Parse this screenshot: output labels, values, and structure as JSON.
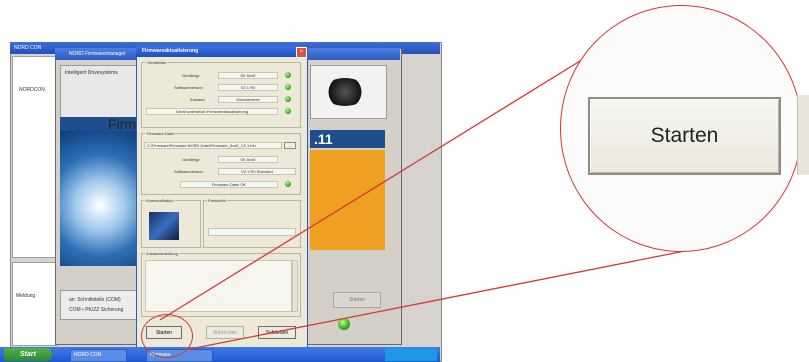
{
  "outer_window": {
    "title": "NORD CON",
    "taskbar_start": "Start",
    "taskbar_items": [
      "NORD CON",
      "Firmware"
    ],
    "tree_item": "NORDCON",
    "message_panel_label": "Meldung"
  },
  "firmware_window": {
    "title": "NORD Firmwaremanager",
    "banner_text": "Intelligent Drivesystems",
    "heading": "Firm",
    "version": ".11",
    "status_lines": [
      "an: Schnittstelle (COM)",
      "COM • PK/ZZ Sicherung"
    ],
    "ghost_button": "Starten"
  },
  "dialog": {
    "title": "Firmwareaktualisierung",
    "close_icon": "close-icon",
    "group_device": "Geräteliste",
    "rows_device": [
      {
        "label": "Gerätetyp",
        "value": "SK 5xxE"
      },
      {
        "label": "Softwareversion",
        "value": "V2.1 R0"
      },
      {
        "label": "Zustand",
        "value": "Einsatzbereit"
      }
    ],
    "device_note": "Gerät unterstützt Firmwareaktualisierung",
    "group_file": "Firmware-Datei",
    "file_path": "C:\\Firmware\\Firmware NORD Datei\\Firmware_5xxE_V2.1.bin",
    "rows_file": [
      {
        "label": "Gerätetyp",
        "value": "SK 5xxE"
      },
      {
        "label": "Softwareversion",
        "value": "V2.1 R0 Standard"
      }
    ],
    "file_ok": "Firmware-Datei OK",
    "group_comm": "Kommunikation",
    "group_progress": "Fortschritt",
    "group_log": "Zustandsmeldung",
    "buttons": {
      "start": "Starten",
      "cancel": "Abbrechen",
      "close": "Schließen"
    }
  },
  "zoom": {
    "button_label": "Starten"
  },
  "colors": {
    "annotation_red": "#d23a3a",
    "status_green": "#35a31c",
    "xp_blue": "#2b5cc4"
  }
}
